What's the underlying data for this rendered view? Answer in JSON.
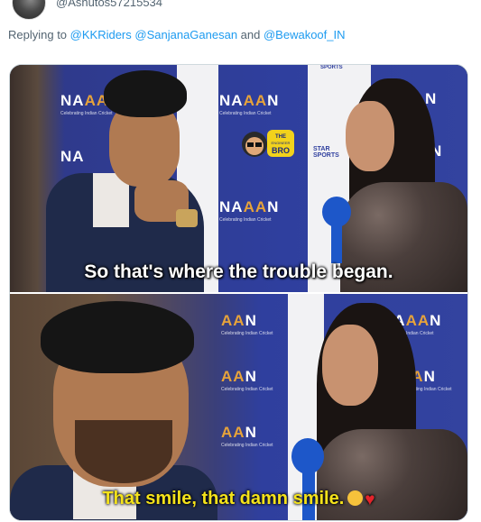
{
  "tweet": {
    "handle": "@Ashutos57215534",
    "reply_prefix": "Replying to ",
    "mentions": [
      "@KKRiders",
      "@SanjanaGanesan"
    ],
    "and_word": " and ",
    "last_mention": "@Bewakoof_IN"
  },
  "meme": {
    "top_caption": "So that's where the trouble began.",
    "bottom_caption": "That smile, that damn smile.",
    "sticker_text_1": "THE",
    "sticker_text_2": "ENGINEER",
    "sticker_text_3": "BRO",
    "backdrop_brand": "NA",
    "backdrop_brand_m": "AA",
    "backdrop_brand_end": "N",
    "backdrop_tag": "Celebrating Indian Cricket",
    "sponsor": "STAR SPORTS",
    "sports_label": "SPORTS"
  },
  "colors": {
    "link": "#1d9bf0",
    "muted": "#536471",
    "caption_top": "#ffffff",
    "caption_bottom": "#f4e21a",
    "backdrop": "#2f3f9e"
  }
}
